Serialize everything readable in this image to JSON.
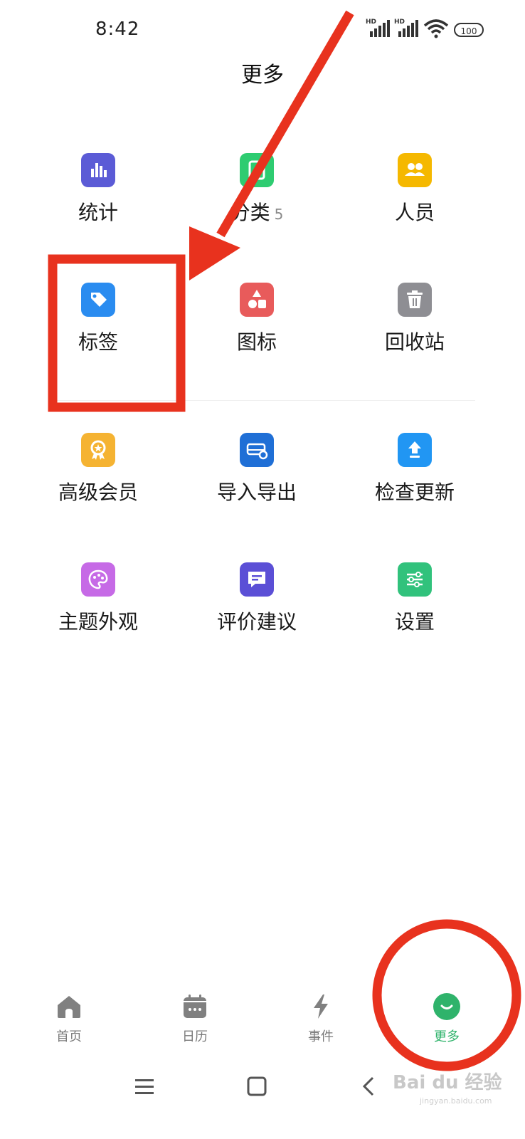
{
  "status": {
    "time": "8:42",
    "signal1_label": "HD",
    "signal2_label": "HD",
    "battery": "100"
  },
  "page": {
    "title": "更多"
  },
  "grid": {
    "items": [
      {
        "label": "统计",
        "icon": "bar-chart-icon",
        "color": "#5b5bd6"
      },
      {
        "label": "分类",
        "count": "5",
        "icon": "category-icon",
        "color": "#2ecc71"
      },
      {
        "label": "人员",
        "icon": "people-icon",
        "color": "#f5b800"
      },
      {
        "label": "标签",
        "icon": "tag-icon",
        "color": "#2a8cf0"
      },
      {
        "label": "图标",
        "icon": "shapes-icon",
        "color": "#e85b5b"
      },
      {
        "label": "回收站",
        "icon": "trash-icon",
        "color": "#8e8e93"
      },
      {
        "label": "高级会员",
        "icon": "premium-badge-icon",
        "color": "#f5b332"
      },
      {
        "label": "导入导出",
        "icon": "import-export-icon",
        "color": "#1f6fd6"
      },
      {
        "label": "检查更新",
        "icon": "upload-arrow-icon",
        "color": "#2196f3"
      },
      {
        "label": "主题外观",
        "icon": "palette-icon",
        "color": "#c66ae6"
      },
      {
        "label": "评价建议",
        "icon": "feedback-icon",
        "color": "#5b4fd6"
      },
      {
        "label": "设置",
        "icon": "sliders-icon",
        "color": "#31c27c"
      }
    ]
  },
  "tabbar": {
    "items": [
      {
        "label": "首页",
        "icon": "home-icon"
      },
      {
        "label": "日历",
        "icon": "calendar-icon"
      },
      {
        "label": "事件",
        "icon": "lightning-icon"
      },
      {
        "label": "更多",
        "icon": "more-smile-icon",
        "active": true
      }
    ],
    "active_color": "#2fb36b"
  },
  "navbar": {
    "icons": [
      "menu-icon",
      "home-square-icon",
      "back-icon"
    ]
  },
  "watermark": {
    "text": "Bai du 经验",
    "sub": "jingyan.baidu.com"
  }
}
